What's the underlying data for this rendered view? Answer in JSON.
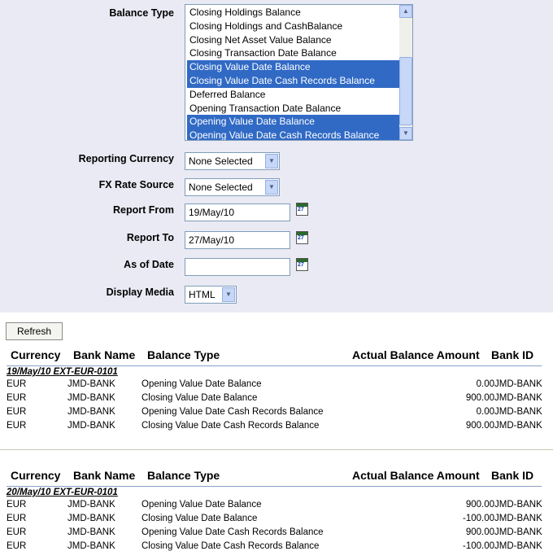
{
  "form": {
    "balance_type": {
      "label": "Balance Type",
      "options": [
        {
          "text": "Closing Holdings Balance",
          "selected": false
        },
        {
          "text": "Closing Holdings and CashBalance",
          "selected": false
        },
        {
          "text": "Closing Net Asset Value Balance",
          "selected": false
        },
        {
          "text": "Closing Transaction Date Balance",
          "selected": false
        },
        {
          "text": "Closing Value Date Balance",
          "selected": true
        },
        {
          "text": "Closing Value Date Cash Records Balance",
          "selected": true
        },
        {
          "text": "Deferred Balance",
          "selected": false
        },
        {
          "text": "Opening Transaction Date Balance",
          "selected": false
        },
        {
          "text": "Opening Value Date Balance",
          "selected": true
        },
        {
          "text": "Opening Value Date Cash Records Balance",
          "selected": true
        }
      ]
    },
    "reporting_currency": {
      "label": "Reporting Currency",
      "value": "None Selected"
    },
    "fx_rate_source": {
      "label": "FX Rate Source",
      "value": "None Selected"
    },
    "report_from": {
      "label": "Report From",
      "value": "19/May/10",
      "cal_icon_text": "27"
    },
    "report_to": {
      "label": "Report To",
      "value": "27/May/10",
      "cal_icon_text": "27"
    },
    "as_of_date": {
      "label": "As of Date",
      "value": "",
      "cal_icon_text": "27"
    },
    "display_media": {
      "label": "Display Media",
      "value": "HTML"
    },
    "refresh_label": "Refresh"
  },
  "table_headers": [
    "Currency",
    "Bank Name",
    "Balance Type",
    "Actual Balance Amount",
    "Bank ID"
  ],
  "report_groups": [
    {
      "label": "19/May/10 EXT-EUR-0101",
      "rows": [
        {
          "currency": "EUR",
          "bank_name": "JMD-BANK",
          "balance_type": "Opening Value Date Balance",
          "amount": "0.00",
          "bank_id": "JMD-BANK"
        },
        {
          "currency": "EUR",
          "bank_name": "JMD-BANK",
          "balance_type": "Closing Value Date Balance",
          "amount": "900.00",
          "bank_id": "JMD-BANK"
        },
        {
          "currency": "EUR",
          "bank_name": "JMD-BANK",
          "balance_type": "Opening Value Date Cash Records Balance",
          "amount": "0.00",
          "bank_id": "JMD-BANK"
        },
        {
          "currency": "EUR",
          "bank_name": "JMD-BANK",
          "balance_type": "Closing Value Date Cash Records Balance",
          "amount": "900.00",
          "bank_id": "JMD-BANK"
        }
      ]
    },
    {
      "label": "20/May/10 EXT-EUR-0101",
      "rows": [
        {
          "currency": "EUR",
          "bank_name": "JMD-BANK",
          "balance_type": "Opening Value Date Balance",
          "amount": "900.00",
          "bank_id": "JMD-BANK"
        },
        {
          "currency": "EUR",
          "bank_name": "JMD-BANK",
          "balance_type": "Closing Value Date Balance",
          "amount": "-100.00",
          "bank_id": "JMD-BANK"
        },
        {
          "currency": "EUR",
          "bank_name": "JMD-BANK",
          "balance_type": "Opening Value Date Cash Records Balance",
          "amount": "900.00",
          "bank_id": "JMD-BANK"
        },
        {
          "currency": "EUR",
          "bank_name": "JMD-BANK",
          "balance_type": "Closing Value Date Cash Records Balance",
          "amount": "-100.00",
          "bank_id": "JMD-BANK"
        }
      ]
    }
  ],
  "colors": {
    "panel_bg": "#eaeaf4",
    "selection": "#316ac5"
  },
  "icons": {
    "calendar": "calendar-icon",
    "dropdown": "chevron-down-icon",
    "scroll_up": "arrow-up-icon",
    "scroll_down": "arrow-down-icon"
  }
}
